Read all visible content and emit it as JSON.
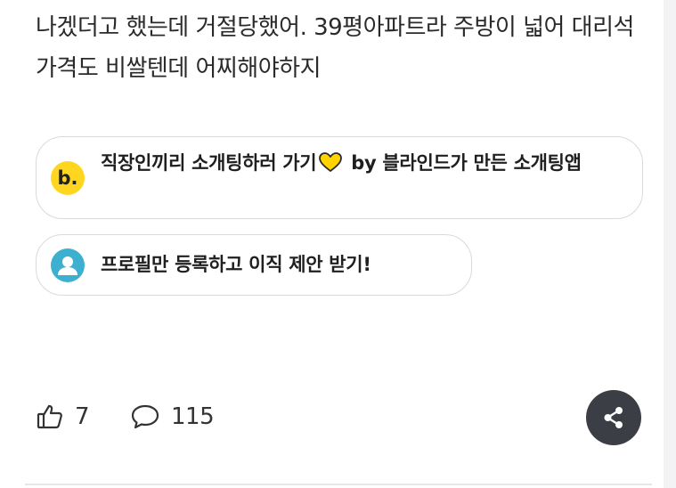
{
  "post": {
    "body_text": "나겠더고 했는데 거절당했어. 39평아파트라 주방이 넓어 대리석 가격도 비쌀텐데 어찌해야하지"
  },
  "promos": {
    "dating": {
      "text": "직장인끼리 소개팅하러 가기",
      "suffix": "by 블라인드가 만든 소개팅앱",
      "icon": "blind-b-logo-icon",
      "logo_letter": "b.",
      "icon_color": "#FFD61F",
      "heart_color": "#FFD400"
    },
    "profile": {
      "text": "프로필만 등록하고 이직 제안 받기!",
      "icon": "user-avatar-icon",
      "icon_color": "#3DB0CF"
    }
  },
  "actions": {
    "like_count": "7",
    "comment_count": "115",
    "like_icon": "thumbs-up-icon",
    "comment_icon": "comment-bubble-icon",
    "share_icon": "share-icon",
    "share_button_color": "#3B3E45"
  }
}
